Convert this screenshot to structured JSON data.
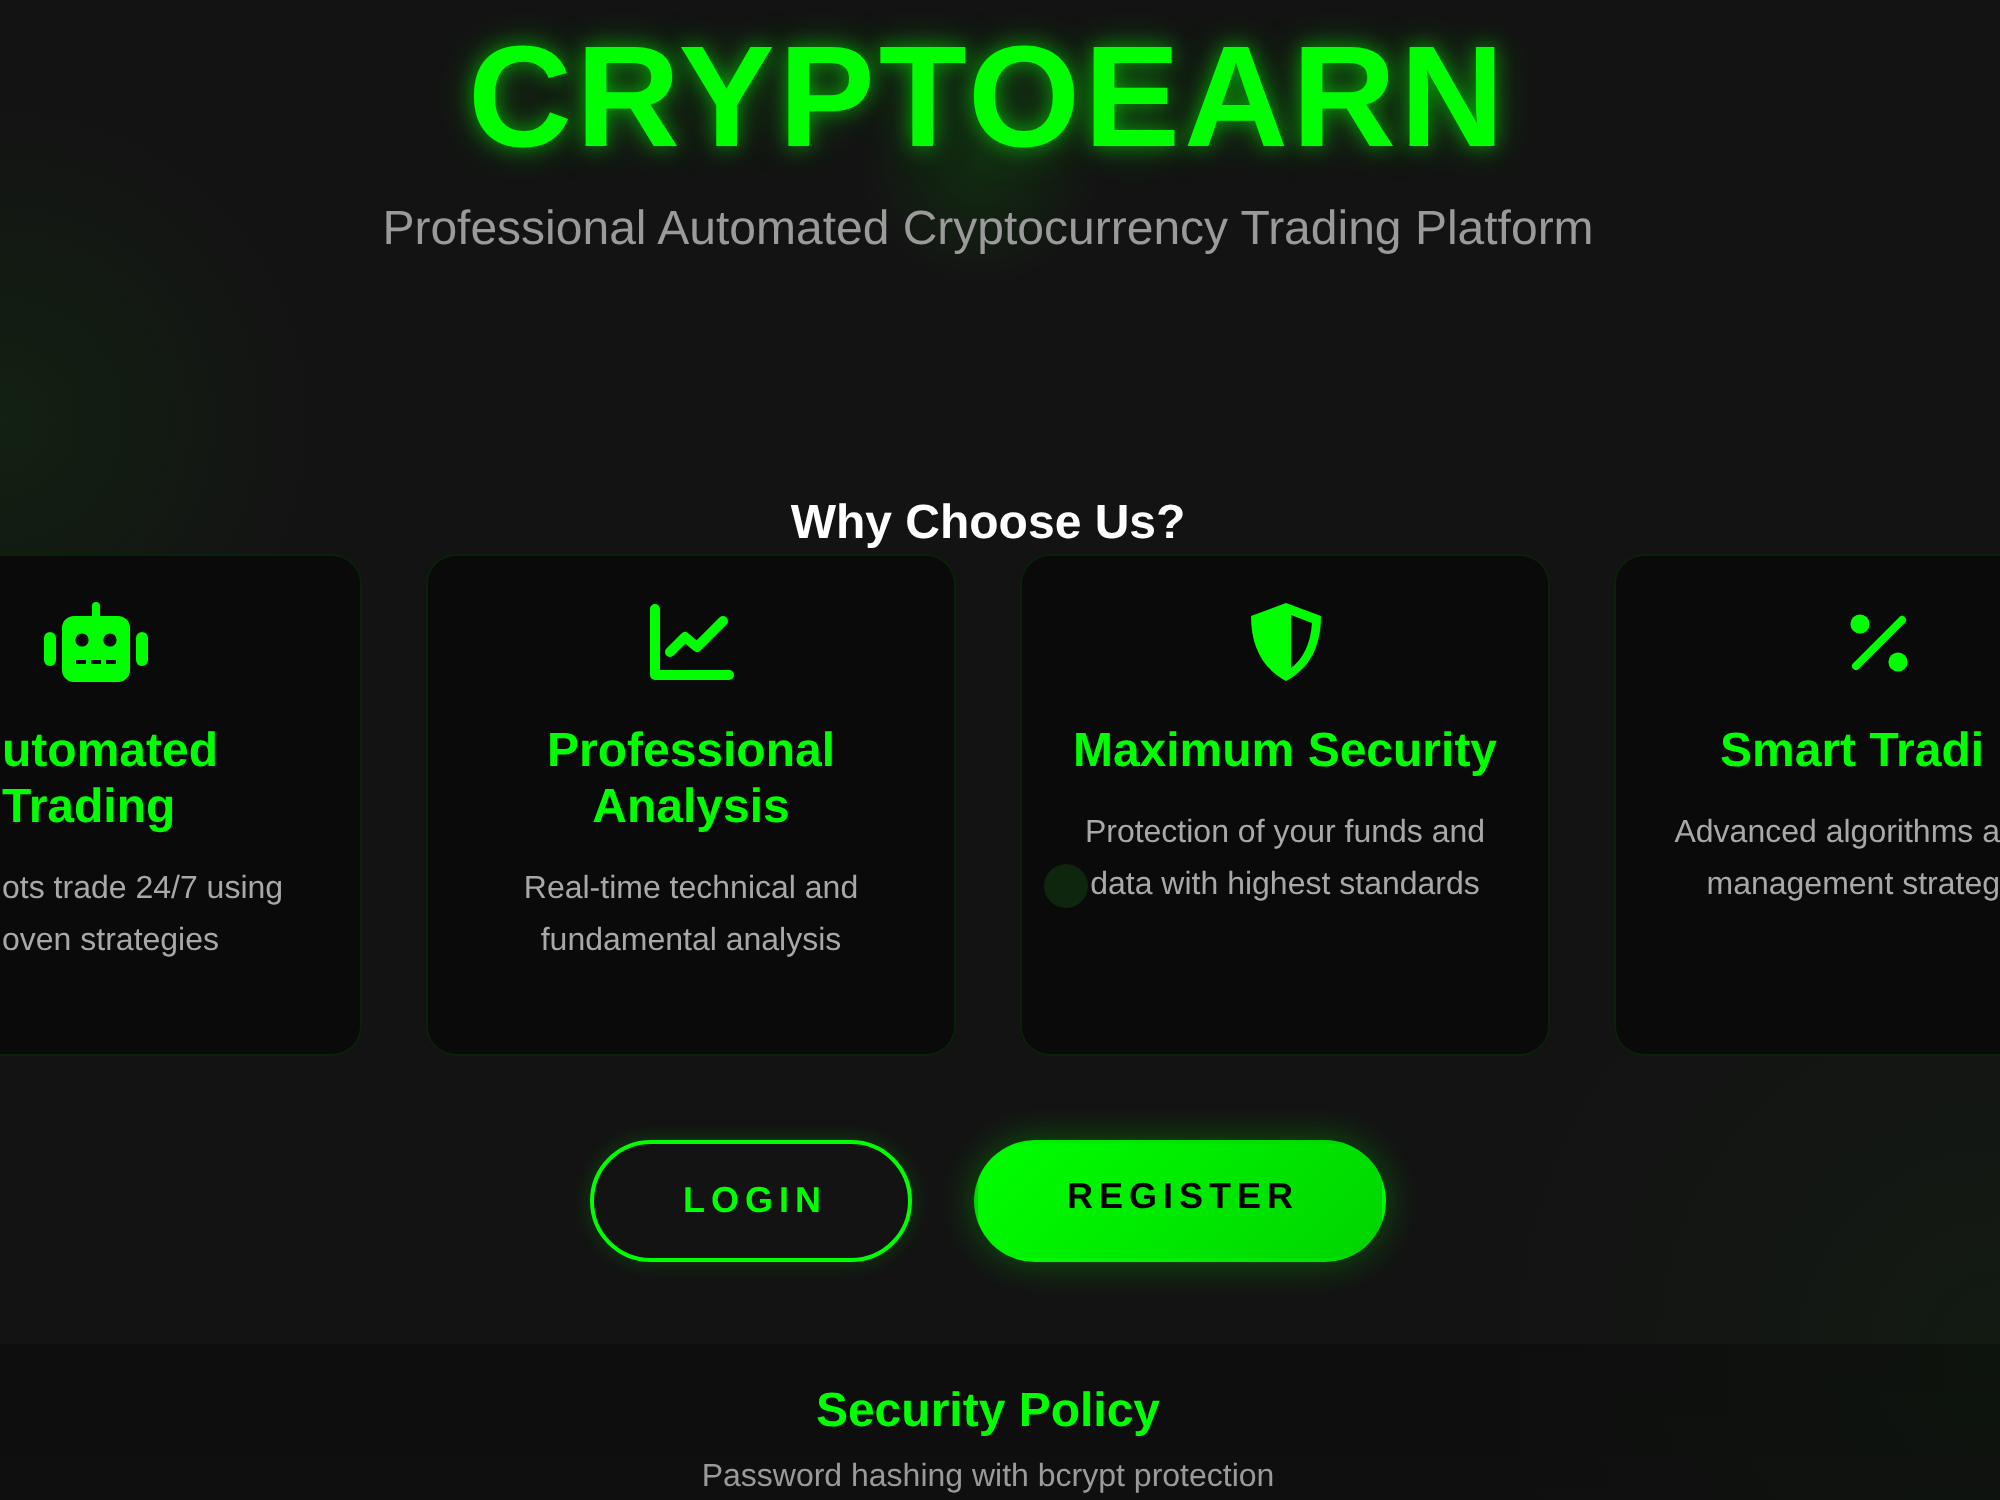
{
  "header": {
    "logo": "CRYPTOEARN",
    "tagline": "Professional Automated Cryptocurrency Trading Platform"
  },
  "features": {
    "heading": "Why Choose Us?",
    "cards": [
      {
        "kind": "automation",
        "title": "utomated Trading",
        "description": "ots trade 24/7 using oven strategies"
      },
      {
        "kind": "analysis",
        "title": "Professional Analysis",
        "description": "Real-time technical and fundamental analysis"
      },
      {
        "kind": "security",
        "title": "Maximum Security",
        "description": "Protection of your funds and data with highest standards"
      },
      {
        "kind": "trading",
        "title": "Smart Tradi",
        "description": "Advanced algorithms a management strateg"
      }
    ]
  },
  "buttons": [
    {
      "label": "LOGIN",
      "kind": "outline"
    },
    {
      "label": "REGISTER",
      "kind": "filled"
    }
  ],
  "security_policy": {
    "title": "Security Policy",
    "items": [
      "Password hashing with bcrypt protection"
    ]
  }
}
